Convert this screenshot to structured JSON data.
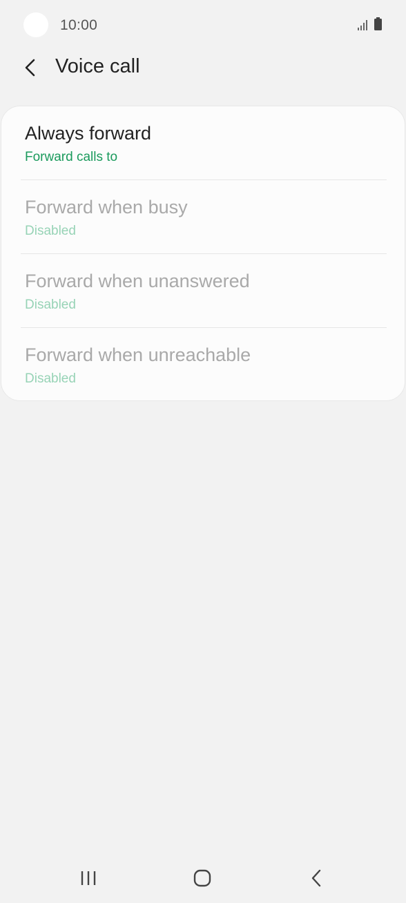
{
  "status_bar": {
    "time": "10:00",
    "icons": [
      "signal-icon",
      "battery-icon"
    ]
  },
  "header": {
    "back_icon": "chevron-left-icon",
    "title": "Voice call"
  },
  "options": [
    {
      "title": "Always forward",
      "subtitle": "Forward calls to",
      "enabled": true
    },
    {
      "title": "Forward when busy",
      "subtitle": "Disabled",
      "enabled": false
    },
    {
      "title": "Forward when unanswered",
      "subtitle": "Disabled",
      "enabled": false
    },
    {
      "title": "Forward when unreachable",
      "subtitle": "Disabled",
      "enabled": false
    }
  ],
  "nav_bar": {
    "buttons": [
      "recent-apps-icon",
      "home-icon",
      "back-icon"
    ]
  },
  "colors": {
    "background": "#f2f2f2",
    "card": "#fcfcfc",
    "accent": "#1a9a5c",
    "accent_disabled": "#97d3b6",
    "text_primary": "#222222",
    "text_disabled": "#a9a9a9"
  }
}
